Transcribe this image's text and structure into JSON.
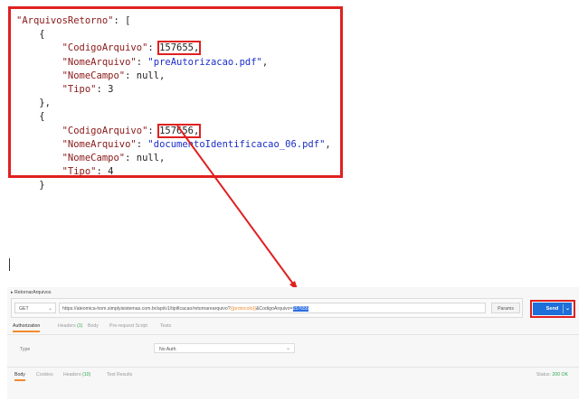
{
  "code": {
    "lines": [
      {
        "indent": "",
        "parts": [
          {
            "c": "k",
            "t": "\"ArquivosRetorno\""
          },
          {
            "c": "p",
            "t": ": ["
          }
        ]
      },
      {
        "indent": "    ",
        "parts": [
          {
            "c": "p",
            "t": "{"
          }
        ]
      },
      {
        "indent": "        ",
        "parts": [
          {
            "c": "k",
            "t": "\"CodigoArquivo\""
          },
          {
            "c": "p",
            "t": ": "
          },
          {
            "c": "n",
            "t": "157655,",
            "hl": true
          }
        ]
      },
      {
        "indent": "        ",
        "parts": [
          {
            "c": "k",
            "t": "\"NomeArquivo\""
          },
          {
            "c": "p",
            "t": ": "
          },
          {
            "c": "s",
            "t": "\"preAutorizacao.pdf\""
          },
          {
            "c": "p",
            "t": ","
          }
        ]
      },
      {
        "indent": "        ",
        "parts": [
          {
            "c": "k",
            "t": "\"NomeCampo\""
          },
          {
            "c": "p",
            "t": ": null,"
          }
        ]
      },
      {
        "indent": "        ",
        "parts": [
          {
            "c": "k",
            "t": "\"Tipo\""
          },
          {
            "c": "p",
            "t": ": 3"
          }
        ]
      },
      {
        "indent": "    ",
        "parts": [
          {
            "c": "p",
            "t": "},"
          }
        ]
      },
      {
        "indent": "    ",
        "parts": [
          {
            "c": "p",
            "t": "{"
          }
        ]
      },
      {
        "indent": "        ",
        "parts": [
          {
            "c": "k",
            "t": "\"CodigoArquivo\""
          },
          {
            "c": "p",
            "t": ": "
          },
          {
            "c": "n",
            "t": "157656,",
            "hl": true
          }
        ]
      },
      {
        "indent": "        ",
        "parts": [
          {
            "c": "k",
            "t": "\"NomeArquivo\""
          },
          {
            "c": "p",
            "t": ": "
          },
          {
            "c": "s",
            "t": "\"documentoIdentificacao_06.pdf\""
          },
          {
            "c": "p",
            "t": ","
          }
        ]
      },
      {
        "indent": "        ",
        "parts": [
          {
            "c": "k",
            "t": "\"NomeCampo\""
          },
          {
            "c": "p",
            "t": ": null,"
          }
        ]
      },
      {
        "indent": "        ",
        "parts": [
          {
            "c": "k",
            "t": "\"Tipo\""
          },
          {
            "c": "p",
            "t": ": 4"
          }
        ]
      },
      {
        "indent": "    ",
        "parts": [
          {
            "c": "p",
            "t": "}"
          }
        ]
      }
    ]
  },
  "request": {
    "title": "▸ RetornarArquivos",
    "method": "GET",
    "method_chevron": "⌄",
    "url_prefix": "https://ateomica-hom.simplyisistemas.com.br/api/v1/tipificacao/retornarearquivo?",
    "url_variable": "{{protocolo}}",
    "url_mid": "&CodigoArquivo=",
    "url_selected": "157655",
    "params_label": "Params",
    "send_label": "Send",
    "send_chevron": "⌄"
  },
  "request_tabs": [
    {
      "label": "Authorization",
      "count": "",
      "active": true
    },
    {
      "label": "Headers ",
      "count": "(1)",
      "active": false
    },
    {
      "label": "Body",
      "count": "",
      "active": false
    },
    {
      "label": "Pre-request Script",
      "count": "",
      "active": false
    },
    {
      "label": "Tests",
      "count": "",
      "active": false
    }
  ],
  "auth": {
    "type_label": "Type",
    "type_value": "No Auth",
    "type_chevron": "⌄"
  },
  "response_tabs": [
    {
      "label": "Body",
      "count": "",
      "active": true
    },
    {
      "label": "Cookies",
      "count": "",
      "active": false
    },
    {
      "label": "Headers ",
      "count": "(10)",
      "active": false
    },
    {
      "label": "Test Results",
      "count": "",
      "active": false
    }
  ],
  "status": {
    "label": "Status: ",
    "value": "200 OK"
  },
  "colors": {
    "highlight_border": "#e02020",
    "send_button": "#1e6fd8",
    "selection": "#2b6de0",
    "json_key": "#8a1818",
    "json_string": "#1c2ec8"
  }
}
